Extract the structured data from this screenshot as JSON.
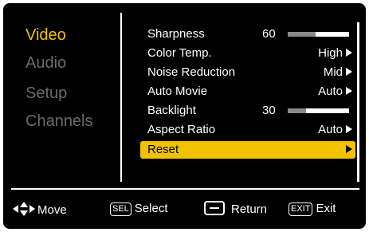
{
  "categories": [
    {
      "label": "Video",
      "active": true
    },
    {
      "label": "Audio",
      "active": false
    },
    {
      "label": "Setup",
      "active": false
    },
    {
      "label": "Channels",
      "active": false
    }
  ],
  "settings": [
    {
      "label": "Sharpness",
      "number": "60",
      "level": 0.45,
      "value": ""
    },
    {
      "label": "Color Temp.",
      "value": "High"
    },
    {
      "label": "Noise Reduction",
      "value": "Mid"
    },
    {
      "label": "Auto Movie",
      "value": "Auto"
    },
    {
      "label": "Backlight",
      "number": "30",
      "level": 0.3,
      "value": ""
    },
    {
      "label": "Aspect Ratio",
      "value": "Auto"
    },
    {
      "label": "Reset",
      "value": "",
      "selected": true
    }
  ],
  "help": {
    "move": "Move",
    "sel_key": "SEL",
    "select": "Select",
    "return": "Return",
    "exit_key": "EXIT",
    "exit": "Exit"
  },
  "colors": {
    "accent": "#f2c200",
    "inactive": "#6b6b6b",
    "background": "#000000"
  }
}
